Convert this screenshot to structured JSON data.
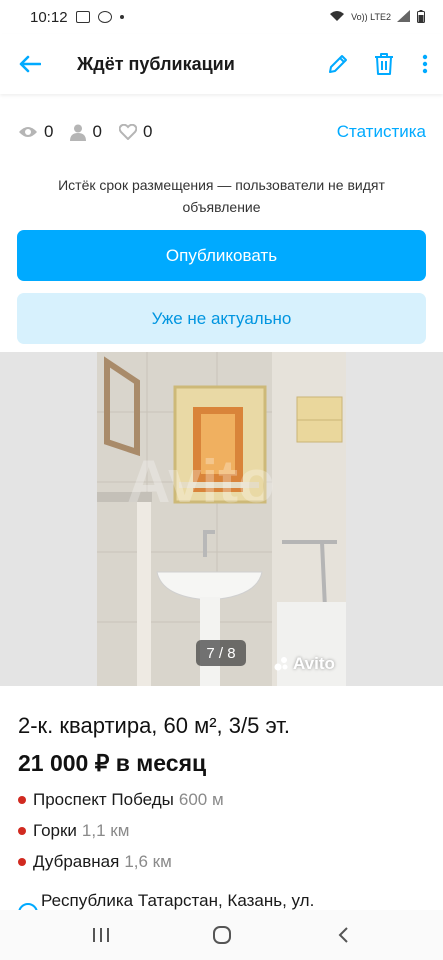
{
  "status_bar": {
    "time": "10:12",
    "network": "Vo)) LTE2"
  },
  "app_bar": {
    "title": "Ждёт публикации"
  },
  "stats": {
    "views": "0",
    "contacts": "0",
    "favorites": "0",
    "statistics_link": "Статистика"
  },
  "notice": "Истёк срок размещения — пользователи не видят объявление",
  "buttons": {
    "publish": "Опубликовать",
    "not_relevant": "Уже не актуально"
  },
  "gallery": {
    "counter": "7 / 8",
    "watermark": "Avito"
  },
  "ad": {
    "title": "2-к. квартира, 60 м², 3/5 эт.",
    "price": "21 000 ₽ в месяц",
    "metro": [
      {
        "name": "Проспект Победы",
        "distance": "600 м"
      },
      {
        "name": "Горки",
        "distance": "1,1 км"
      },
      {
        "name": "Дубравная",
        "distance": "1,6 км"
      }
    ],
    "address": "Республика Татарстан, Казань, ул."
  },
  "colors": {
    "accent": "#00aaff",
    "secondary_bg": "#d7f1fd",
    "metro_dot": "#d12a20"
  }
}
